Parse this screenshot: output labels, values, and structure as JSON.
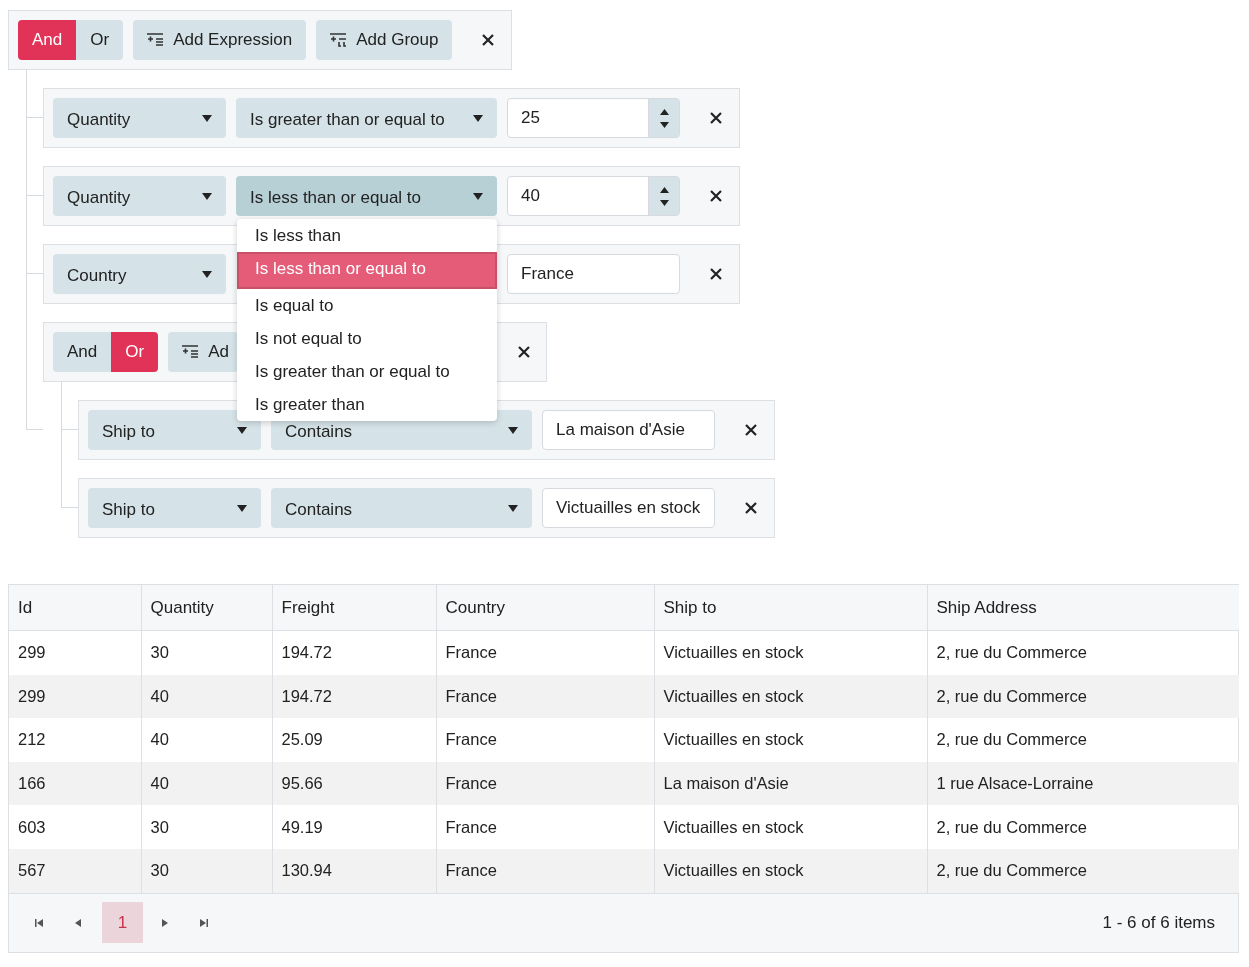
{
  "root_group": {
    "logic": [
      {
        "label": "And",
        "selected": true
      },
      {
        "label": "Or",
        "selected": false
      }
    ],
    "add_expression": "Add Expression",
    "add_group": "Add Group",
    "children": [
      {
        "kind": "expression",
        "field": "Quantity",
        "operator": "Is greater than or equal to",
        "operator_open": false,
        "value": {
          "kind": "numeric",
          "text": "25"
        }
      },
      {
        "kind": "expression",
        "field": "Quantity",
        "operator": "Is less than or equal to",
        "operator_open": true,
        "value": {
          "kind": "numeric",
          "text": "40"
        }
      },
      {
        "kind": "expression",
        "field": "Country",
        "operator_open": false,
        "value": {
          "kind": "text",
          "text": "France"
        }
      },
      {
        "kind": "group",
        "logic": [
          {
            "label": "And",
            "selected": false
          },
          {
            "label": "Or",
            "selected": true
          }
        ],
        "add_expression": "Ad",
        "children": [
          {
            "kind": "expression",
            "field": "Ship to",
            "operator": "Contains",
            "operator_open": false,
            "value": {
              "kind": "text",
              "text": "La maison d'Asie"
            }
          },
          {
            "kind": "expression",
            "field": "Ship to",
            "operator": "Contains",
            "operator_open": false,
            "value": {
              "kind": "text",
              "text": "Victuailles en stock"
            }
          }
        ]
      }
    ]
  },
  "operator_menu": {
    "items": [
      {
        "label": "Is less than",
        "selected": false
      },
      {
        "label": "Is less than or equal to",
        "selected": true
      },
      {
        "label": "Is equal to",
        "selected": false
      },
      {
        "label": "Is not equal to",
        "selected": false
      },
      {
        "label": "Is greater than or equal to",
        "selected": false
      },
      {
        "label": "Is greater than",
        "selected": false
      }
    ]
  },
  "grid": {
    "columns": [
      "Id",
      "Quantity",
      "Freight",
      "Country",
      "Ship to",
      "Ship Address"
    ],
    "rows": [
      [
        "299",
        "30",
        "194.72",
        "France",
        "Victuailles en stock",
        "2, rue du Commerce"
      ],
      [
        "299",
        "40",
        "194.72",
        "France",
        "Victuailles en stock",
        "2, rue du Commerce"
      ],
      [
        "212",
        "40",
        "25.09",
        "France",
        "Victuailles en stock",
        "2, rue du Commerce"
      ],
      [
        "166",
        "40",
        "95.66",
        "France",
        "La maison d'Asie",
        "1 rue Alsace-Lorraine"
      ],
      [
        "603",
        "30",
        "49.19",
        "France",
        "Victuailles en stock",
        "2, rue du Commerce"
      ],
      [
        "567",
        "30",
        "130.94",
        "France",
        "Victuailles en stock",
        "2, rue du Commerce"
      ]
    ],
    "pager": {
      "pages": [
        {
          "label": "1",
          "selected": true
        }
      ],
      "summary": "1 - 6 of 6 items"
    }
  }
}
